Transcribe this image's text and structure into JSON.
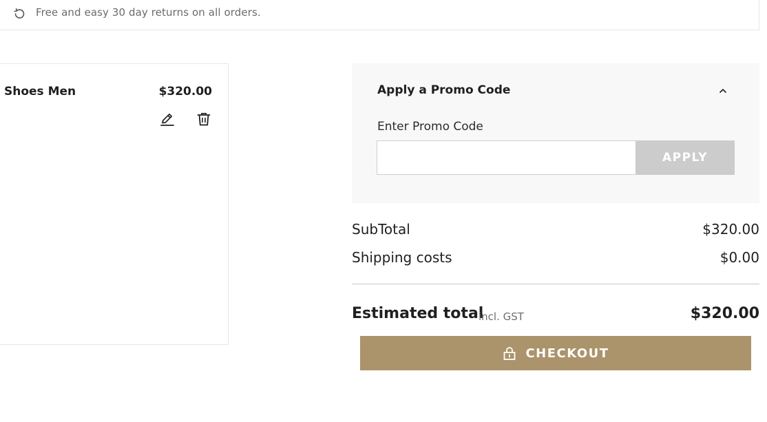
{
  "banner": {
    "icon": "undo-return-icon",
    "text": "Free and easy 30 day returns on all orders."
  },
  "cart_item": {
    "name": "Shoes Men",
    "price": "$320.00",
    "edit_icon": "pencil-icon",
    "delete_icon": "trash-icon"
  },
  "promo": {
    "title": "Apply a Promo Code",
    "chevron_icon": "chevron-up-icon",
    "input_label": "Enter Promo Code",
    "input_value": "",
    "input_placeholder": "",
    "apply_label": "APPLY"
  },
  "summary": {
    "subtotal_label": "SubTotal",
    "subtotal_value": "$320.00",
    "shipping_label": "Shipping costs",
    "shipping_value": "$0.00",
    "total_label": "Estimated total",
    "total_note": "incl. GST",
    "total_value": "$320.00"
  },
  "checkout": {
    "icon": "lock-icon",
    "label": "CHECKOUT"
  },
  "colors": {
    "accent": "#ab936b",
    "apply_disabled": "#cccccc",
    "panel_bg": "#f8f8f8"
  }
}
